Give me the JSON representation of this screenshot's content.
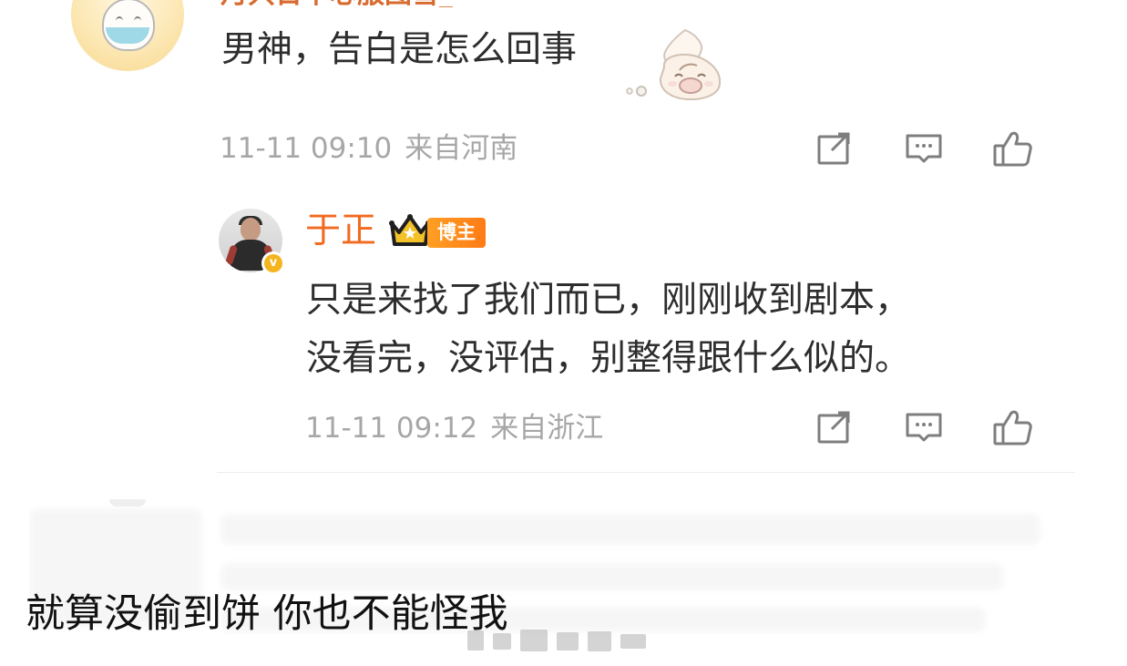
{
  "comment": {
    "top_name_partial": "月只日中心服图雪_",
    "text": "男神，告白是怎么回事",
    "meta": {
      "time": "11-11 09:10",
      "location": "来自河南"
    },
    "actions": [
      "share-icon",
      "comment-icon",
      "like-icon"
    ]
  },
  "reply": {
    "name": "于正",
    "badge": "博主",
    "text_lines": [
      "只是来找了我们而已，刚刚收到剧本，",
      "没看完，没评估，别整得跟什么似的。"
    ],
    "meta": {
      "time": "11-11 09:12",
      "location": "来自浙江"
    },
    "actions": [
      "share-icon",
      "comment-icon",
      "like-icon"
    ]
  },
  "caption": {
    "text": "就算没偷到饼 你也不能怪我"
  },
  "colors": {
    "meta": "#a7a7a7",
    "reply_name": "#f16a1f",
    "badge_bg": "#ff8c1a",
    "text": "#2d2d2d"
  }
}
